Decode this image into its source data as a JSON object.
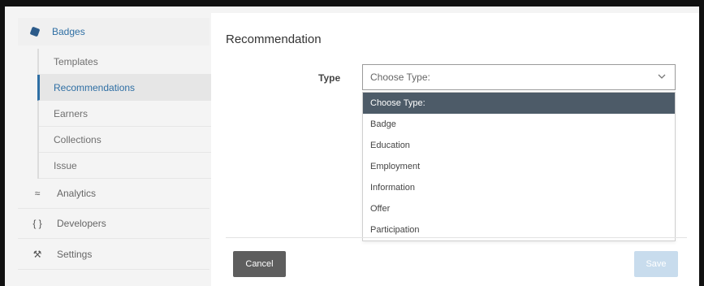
{
  "sidebar": {
    "badges_label": "Badges",
    "submenu": [
      "Templates",
      "Recommendations",
      "Earners",
      "Collections",
      "Issue"
    ],
    "active_submenu": "Recommendations",
    "items": [
      {
        "label": "Analytics",
        "icon": "analytics-icon"
      },
      {
        "label": "Developers",
        "icon": "braces-icon"
      },
      {
        "label": "Settings",
        "icon": "tools-icon"
      }
    ]
  },
  "main": {
    "title": "Recommendation",
    "type_label": "Type",
    "select_value": "Choose Type:",
    "options": [
      "Choose Type:",
      "Badge",
      "Education",
      "Employment",
      "Information",
      "Offer",
      "Participation"
    ],
    "selected_option": "Choose Type:",
    "cancel_label": "Cancel",
    "save_label": "Save"
  },
  "colors": {
    "accent": "#2f6fa4",
    "selected_option_bg": "#4d5b68",
    "cancel_bg": "#5e5e5e",
    "save_bg_disabled": "#c8dced"
  }
}
